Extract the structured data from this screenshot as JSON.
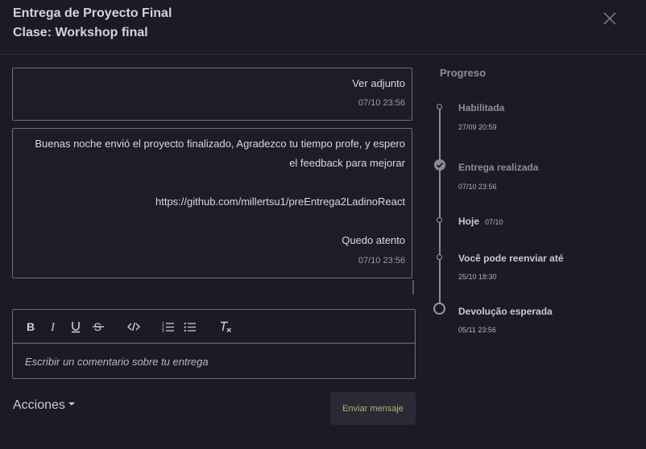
{
  "header": {
    "title": "Entrega de Proyecto Final",
    "subtitle": "Clase: Workshop final",
    "close_icon": "close-icon"
  },
  "messages": [
    {
      "lines": [
        "Ver adjunto"
      ],
      "time": "07/10 23:56"
    },
    {
      "lines": [
        "Buenas noche envió el proyecto finalizado, Agradezco tu tiempo profe, y espero",
        "el feedback para mejorar",
        "https://github.com/millertsu1/preEntrega2LadinoReact",
        "Quedo atento"
      ],
      "time": "07/10 23:56"
    }
  ],
  "editor": {
    "toolbar_icons": [
      "bold-icon",
      "italic-icon",
      "underline-icon",
      "strikethrough-icon",
      "code-icon",
      "ordered-list-icon",
      "bullet-list-icon",
      "clear-format-icon"
    ],
    "placeholder": "Escribir un comentario sobre tu entrega"
  },
  "actions": {
    "acciones_label": "Acciones",
    "send_label": "Enviar mensaje"
  },
  "progress": {
    "title": "Progreso",
    "steps": [
      {
        "label": "Habilitada",
        "date": "27/09 20:59",
        "state": "done"
      },
      {
        "label": "Entrega realizada",
        "date": "07/10 23:56",
        "state": "checked"
      },
      {
        "label": "Hoje",
        "date": "07/10",
        "state": "current"
      },
      {
        "label": "Você pode reenviar até",
        "date": "25/10 18:30",
        "state": "current"
      },
      {
        "label": "Devolução esperada",
        "date": "05/11 23:56",
        "state": "pending"
      }
    ]
  },
  "colors": {
    "background": "#1b1b26",
    "border": "#6f6f78",
    "send_text": "#b9b06a"
  }
}
